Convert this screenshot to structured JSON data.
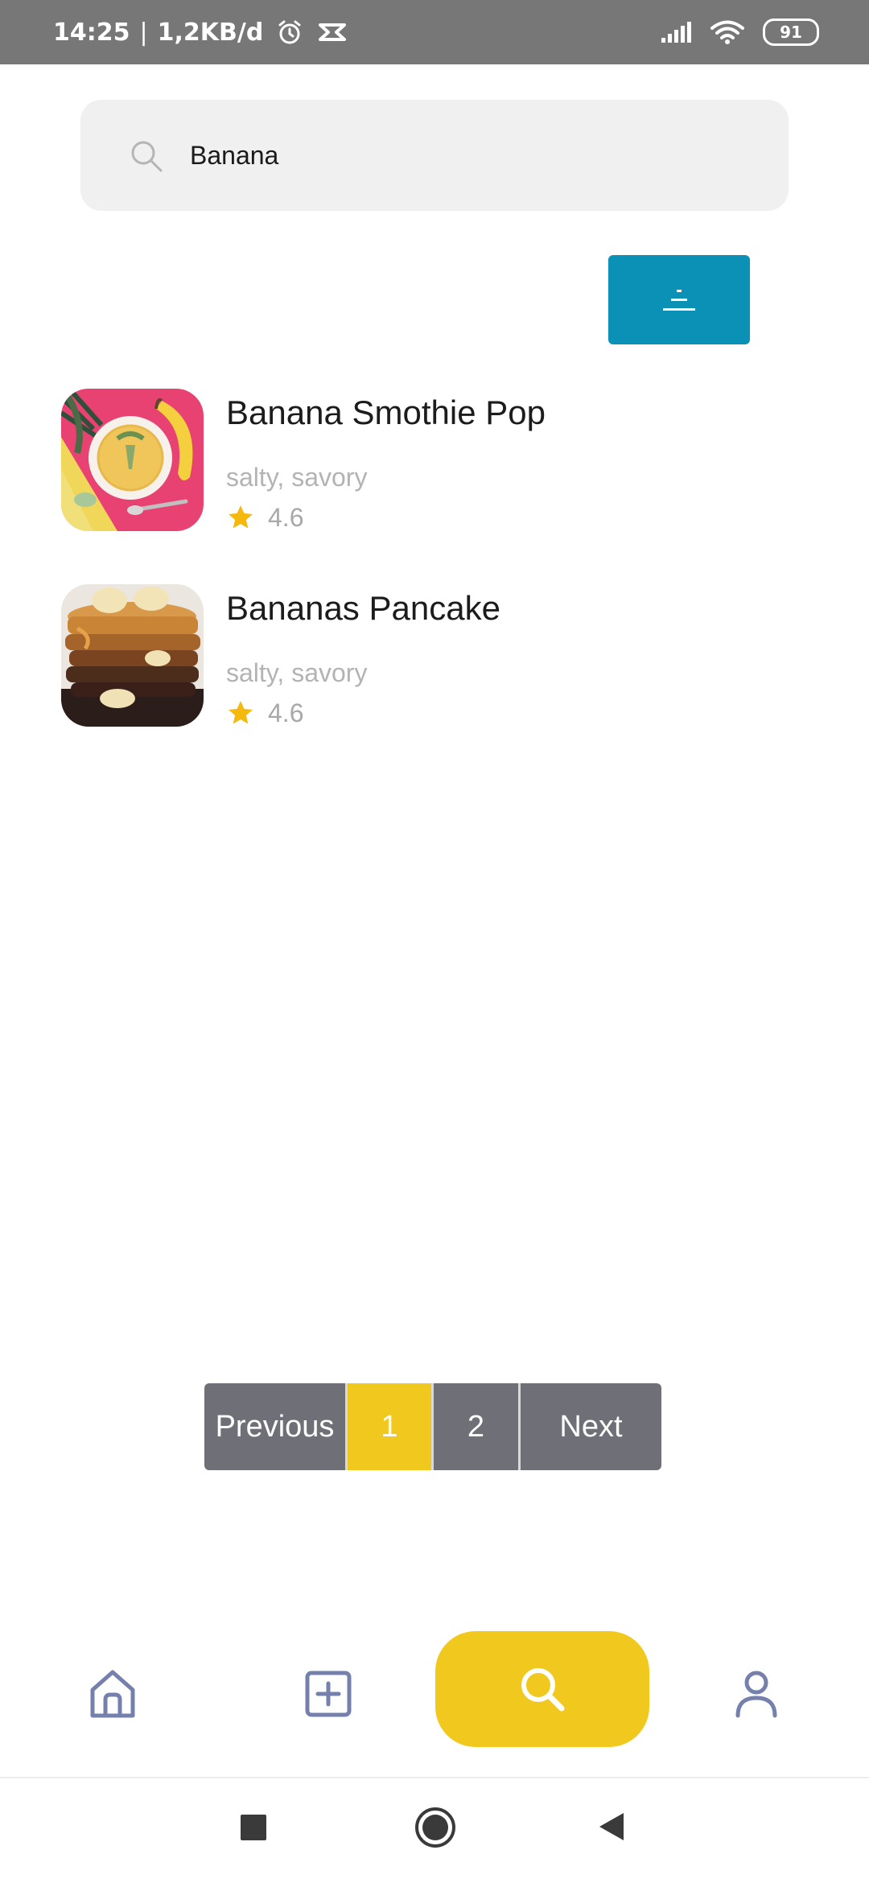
{
  "status_bar": {
    "time": "14:25",
    "separator": "|",
    "network_speed": "1,2KB/d",
    "battery": "91",
    "icons": [
      "alarm-icon",
      "capcut-icon",
      "signal-icon",
      "wifi-icon",
      "battery-icon"
    ]
  },
  "search": {
    "value": "Banana",
    "icon": "search-icon"
  },
  "filter_button": {
    "icon": "filter-icon",
    "color": "#0b91b6"
  },
  "results": [
    {
      "title": "Banana Smothie Pop",
      "tags": "salty, savory",
      "rating": "4.6",
      "image": "banana-smoothie-photo"
    },
    {
      "title": "Bananas Pancake",
      "tags": "salty, savory",
      "rating": "4.6",
      "image": "banana-pancake-photo"
    }
  ],
  "pagination": {
    "previous_label": "Previous",
    "pages": [
      "1",
      "2"
    ],
    "active_page": "1",
    "next_label": "Next",
    "active_color": "#f1c91e",
    "inactive_color": "#6f7077"
  },
  "bottom_nav": {
    "items": [
      "home-icon",
      "add-icon",
      "search-icon",
      "profile-icon"
    ],
    "active": "search-icon",
    "active_color": "#f1c91e",
    "icon_color": "#7580ad"
  },
  "system_nav": {
    "icons": [
      "recents-icon",
      "home-circle-icon",
      "back-icon"
    ]
  }
}
